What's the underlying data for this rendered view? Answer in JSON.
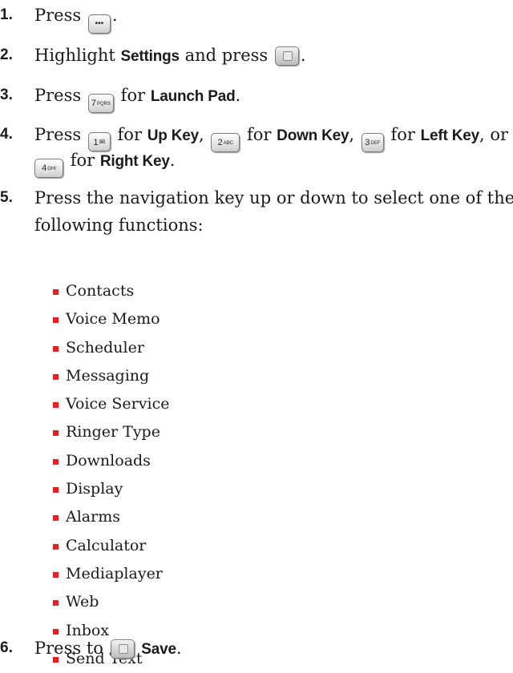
{
  "steps": [
    {
      "num": "1.",
      "text_before": "Press",
      "key": "menu",
      "key_label": "•••",
      "text_after": "."
    },
    {
      "num": "2.",
      "text_before": "Highlight",
      "bold_1": "Settings",
      "text_mid": "and press",
      "key": "ok",
      "text_after": "."
    },
    {
      "num": "3.",
      "text_before": "Press",
      "key_label": "7",
      "key_sub": "PQRS",
      "text_mid": "for",
      "bold_1": "Launch Pad",
      "text_after": "."
    },
    {
      "num": "4.",
      "text_before": "Press",
      "key1_label": "1",
      "key1_sub": "✉",
      "for_1": "for",
      "bold_1": "Up Key",
      "comma_1": ",",
      "key2_label": "2",
      "key2_sub": "ABC",
      "for_2": "for",
      "bold_2": "Down Key",
      "comma_2": ",",
      "key3_label": "3",
      "key3_sub": "DEF",
      "for_3": "for",
      "bold_3": "Left Key",
      "or": ", or",
      "key4_label": "4",
      "key4_sub": "GHI",
      "for_4": "for",
      "bold_4": "Right Key",
      "text_after": "."
    },
    {
      "num": "5.",
      "line1": "Press the navigation key up or down to select one of the",
      "line2": "following functions:"
    },
    {
      "num": "6.",
      "text_before": "Press to",
      "key": "ok",
      "bold_1": "Save",
      "text_after": "."
    }
  ],
  "functions": [
    "Contacts",
    "Voice Memo",
    "Scheduler",
    "Messaging",
    "Voice Service",
    "Ringer Type",
    "Downloads",
    "Display",
    "Alarms",
    "Calculator",
    "Mediaplayer",
    "Web",
    "Inbox",
    "Send Text"
  ]
}
